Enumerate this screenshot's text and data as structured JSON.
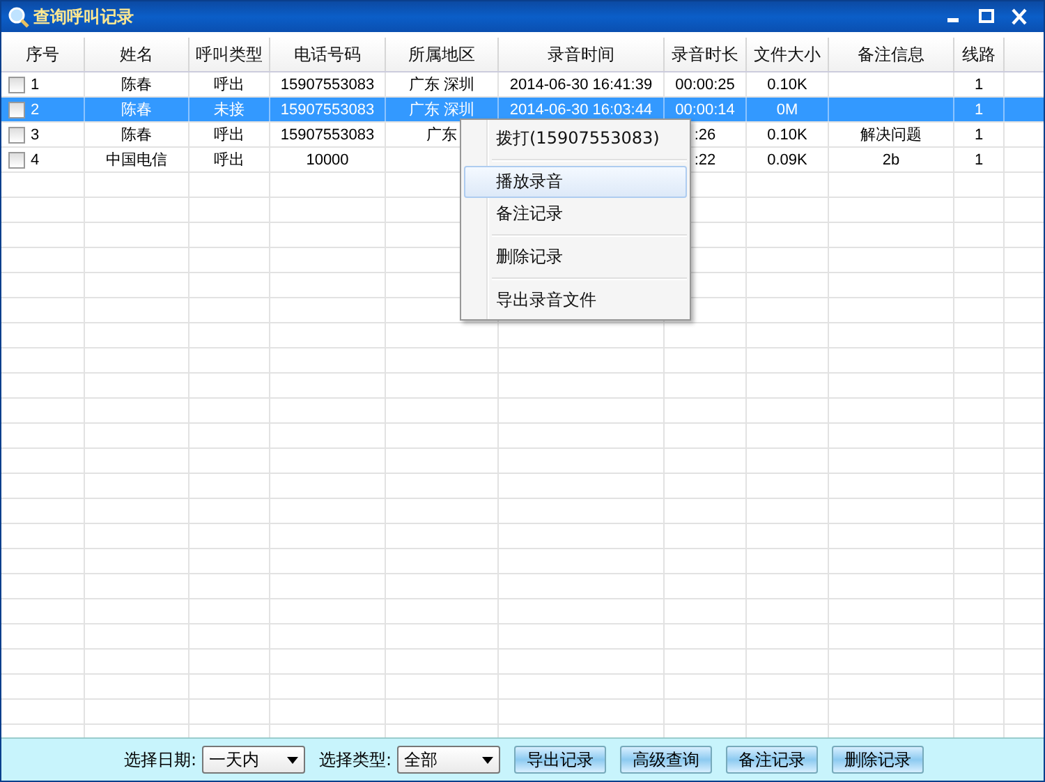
{
  "window": {
    "title": "查询呼叫记录"
  },
  "table": {
    "columns": [
      "序号",
      "姓名",
      "呼叫类型",
      "电话号码",
      "所属地区",
      "录音时间",
      "录音时长",
      "文件大小",
      "备注信息",
      "线路"
    ],
    "rows": [
      {
        "checked": false,
        "selected": false,
        "cells": [
          "1",
          "陈春",
          "呼出",
          "15907553083",
          "广东 深圳",
          "2014-06-30 16:41:39",
          "00:00:25",
          "0.10K",
          "",
          "1"
        ]
      },
      {
        "checked": false,
        "selected": true,
        "cells": [
          "2",
          "陈春",
          "未接",
          "15907553083",
          "广东 深圳",
          "2014-06-30 16:03:44",
          "00:00:14",
          "0M",
          "",
          "1"
        ]
      },
      {
        "checked": false,
        "selected": false,
        "cells": [
          "3",
          "陈春",
          "呼出",
          "15907553083",
          "广东",
          "",
          ":26",
          "0.10K",
          "解决问题",
          "1"
        ]
      },
      {
        "checked": false,
        "selected": false,
        "cells": [
          "4",
          "中国电信",
          "呼出",
          "10000",
          "",
          "",
          ":22",
          "0.09K",
          "2b",
          "1"
        ]
      }
    ]
  },
  "context_menu": [
    {
      "kind": "item",
      "label": "拨打(15907553083)",
      "selected": false
    },
    {
      "kind": "separator"
    },
    {
      "kind": "item",
      "label": "播放录音",
      "selected": true
    },
    {
      "kind": "item",
      "label": "备注记录",
      "selected": false
    },
    {
      "kind": "separator"
    },
    {
      "kind": "item",
      "label": "删除记录",
      "selected": false
    },
    {
      "kind": "separator"
    },
    {
      "kind": "item",
      "label": "导出录音文件",
      "selected": false
    }
  ],
  "toolbar": {
    "date_label": "选择日期:",
    "date_value": "一天内",
    "type_label": "选择类型:",
    "type_value": "全部",
    "buttons": [
      "导出记录",
      "高级查询",
      "备注记录",
      "删除记录"
    ]
  }
}
